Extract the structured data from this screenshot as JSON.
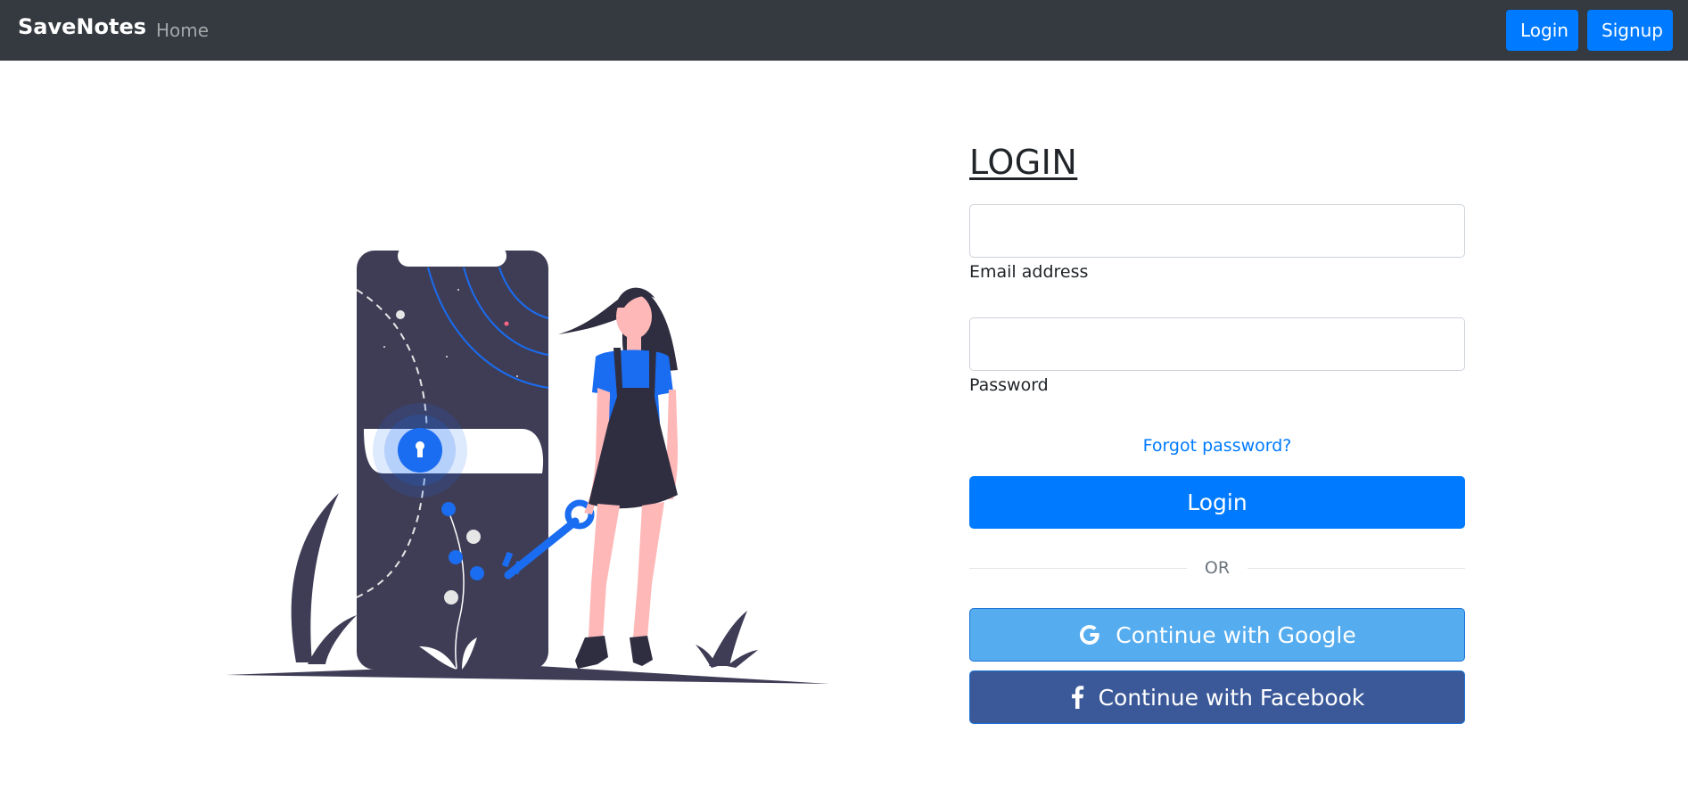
{
  "navbar": {
    "brand": "SaveNotes",
    "home": "Home",
    "login": "Login",
    "signup": "Signup",
    "background": "#343a40"
  },
  "form": {
    "title": "LOGIN",
    "email": {
      "label": "Email address",
      "value": "",
      "placeholder": ""
    },
    "password": {
      "label": "Password",
      "value": "",
      "placeholder": ""
    },
    "forgot_password": "Forgot password?",
    "login_button": "Login",
    "divider": "OR",
    "google_button": "Continue with Google",
    "facebook_button": "Continue with Facebook"
  },
  "icons": {
    "google": "google-icon",
    "facebook": "facebook-icon",
    "illustration": "secure-login-illustration"
  },
  "colors": {
    "primary": "#007bff",
    "google": "#55acee",
    "facebook": "#3b5998",
    "illustration_dark": "#3f3d56",
    "illustration_accent": "#1a6cf0",
    "skin": "#ffb8b8"
  }
}
